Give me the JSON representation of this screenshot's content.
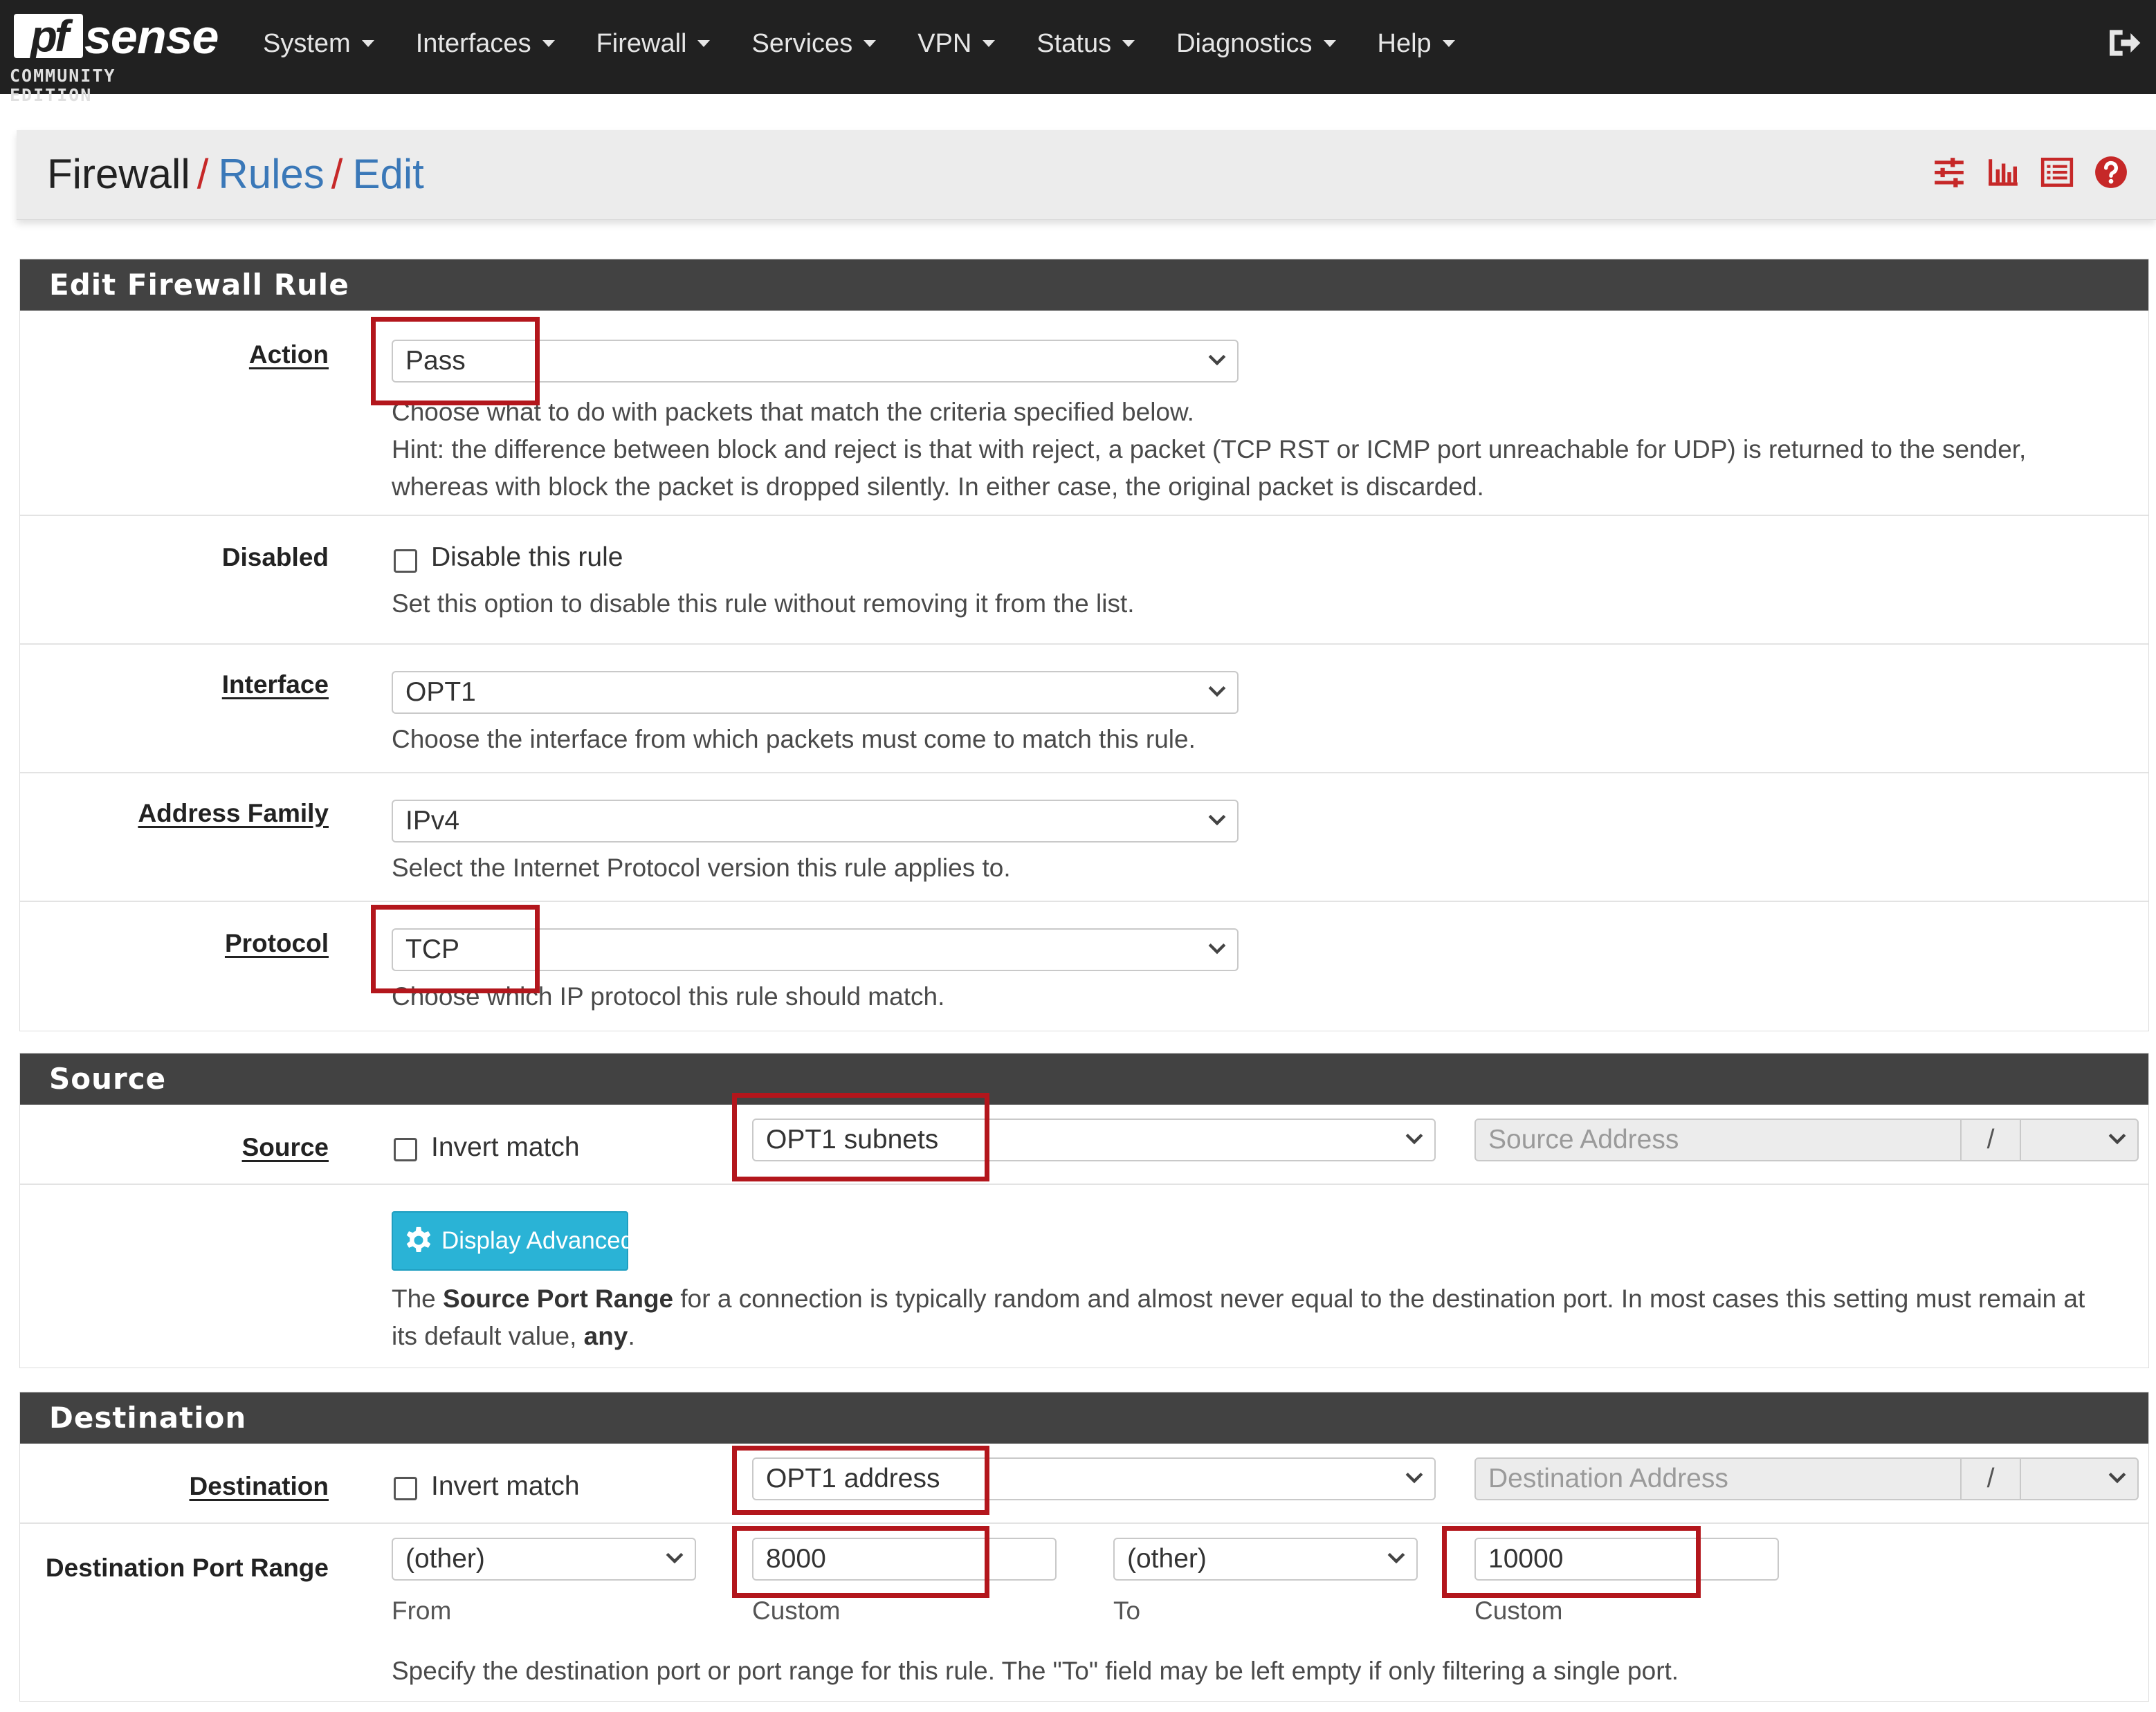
{
  "brand": {
    "logo_pf": "pf",
    "logo_sense": "sense",
    "edition": "COMMUNITY EDITION"
  },
  "nav": [
    "System",
    "Interfaces",
    "Firewall",
    "Services",
    "VPN",
    "Status",
    "Diagnostics",
    "Help"
  ],
  "icons": {
    "logout": "logout-icon",
    "toolbar": [
      "sliders-icon",
      "bar-chart-icon",
      "list-icon",
      "help-circle-icon"
    ],
    "accent": "#c62828"
  },
  "breadcrumb": {
    "root": "Firewall",
    "sep": "/",
    "rules": "Rules",
    "edit": "Edit"
  },
  "edit_panel": {
    "title": "Edit Firewall Rule",
    "action": {
      "label": "Action",
      "value": "Pass",
      "help1": "Choose what to do with packets that match the criteria specified below.",
      "help2": "Hint: the difference between block and reject is that with reject, a packet (TCP RST or ICMP port unreachable for UDP) is returned to the sender,",
      "help3": "whereas with block the packet is dropped silently. In either case, the original packet is discarded."
    },
    "disabled": {
      "label": "Disabled",
      "checkbox": "Disable this rule",
      "help": "Set this option to disable this rule without removing it from the list."
    },
    "interface": {
      "label": "Interface",
      "value": "OPT1",
      "help": "Choose the interface from which packets must come to match this rule."
    },
    "family": {
      "label": "Address Family",
      "value": "IPv4",
      "help": "Select the Internet Protocol version this rule applies to."
    },
    "protocol": {
      "label": "Protocol",
      "value": "TCP",
      "help": "Choose which IP protocol this rule should match."
    }
  },
  "source_panel": {
    "title": "Source",
    "label": "Source",
    "invert": "Invert match",
    "type": "OPT1 subnets",
    "address_placeholder": "Source Address",
    "mask_sep": "/",
    "advanced_button": "Display Advanced",
    "help_pre": "The ",
    "help_bold": "Source Port Range",
    "help_post": " for a connection is typically random and almost never equal to the destination port. In most cases this setting must remain at",
    "help2_pre": "its default value, ",
    "help2_bold": "any",
    "help2_post": "."
  },
  "dest_panel": {
    "title": "Destination",
    "label": "Destination",
    "invert": "Invert match",
    "type": "OPT1 address",
    "address_placeholder": "Destination Address",
    "mask_sep": "/",
    "port_range": {
      "label": "Destination Port Range",
      "from_select": "(other)",
      "from_custom": "8000",
      "to_select": "(other)",
      "to_custom": "10000",
      "from_label": "From",
      "custom_label": "Custom",
      "to_label": "To",
      "help": "Specify the destination port or port range for this rule. The \"To\" field may be left empty if only filtering a single port."
    }
  }
}
